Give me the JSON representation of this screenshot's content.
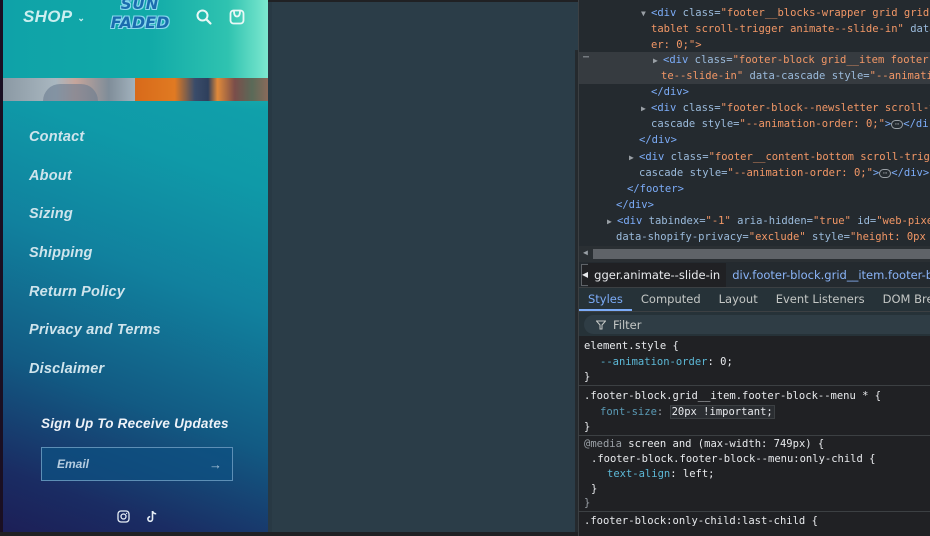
{
  "preview": {
    "header": {
      "shop_label": "SHOP",
      "logo_line1": "SUN",
      "logo_line2": "FADED",
      "icons": [
        "search-icon",
        "cart-icon"
      ]
    },
    "menu": [
      {
        "label": "Contact"
      },
      {
        "label": "About"
      },
      {
        "label": "Sizing"
      },
      {
        "label": "Shipping"
      },
      {
        "label": "Return Policy"
      },
      {
        "label": "Privacy and Terms"
      },
      {
        "label": "Disclaimer"
      }
    ],
    "newsletter": {
      "title": "Sign Up To Receive Updates",
      "email_placeholder": "Email",
      "submit_icon": "arrow-right-icon"
    },
    "socials": [
      "instagram-icon",
      "tiktok-icon"
    ]
  },
  "devtools": {
    "dom": {
      "l1_tag": "<div",
      "l1_attr": " class=",
      "l1_val": "\"footer__blocks-wrapper grid grid-",
      "l2_val": "tablet scroll-trigger animate--slide-in\"",
      "l2_attr": " data",
      "l3": "er: 0;\">",
      "l4_tag": "<div",
      "l4_attr": " class=",
      "l4_val": "\"footer-block grid__item footer-",
      "l5_val": "te--slide-in\"",
      "l5_attr": " data-cascade style=",
      "l5_val2": "\"--animati",
      "l6": "</div>",
      "l7_tag": "<div",
      "l7_attr": " class=",
      "l7_val": "\"footer-block--newsletter scroll-t",
      "l8_attr": "cascade style=",
      "l8_val": "\"--animation-order: 0;\"",
      "l8_tail": "</di",
      "l9": "</div>",
      "l10_tag": "<div",
      "l10_attr": " class=",
      "l10_val": "\"footer__content-bottom scroll-trigg",
      "l11_attr": "cascade style=",
      "l11_val": "\"--animation-order: 0;\"",
      "l11_tail": "</div>",
      "l12": "</footer>",
      "l13": "</div>",
      "l14_tag": "<div",
      "l14_attr1": " tabindex=",
      "l14_val1": "\"-1\"",
      "l14_attr2": " aria-hidden=",
      "l14_val2": "\"true\"",
      "l14_attr3": " id=",
      "l14_val3": "\"web-pixel",
      "l15_attr1": "data-shopify-privacy=",
      "l15_val1": "\"exclude\"",
      "l15_attr2": " style=",
      "l15_val2": "\"height: 0px"
    },
    "breadcrumbs": [
      "gger.animate--slide-in",
      "div.footer-block.grid__item.footer-block--"
    ],
    "tabs": [
      "Styles",
      "Computed",
      "Layout",
      "Event Listeners",
      "DOM Breakpoints"
    ],
    "active_tab": "Styles",
    "filter_placeholder": "Filter",
    "styles": {
      "r1_sel": "element.style {",
      "r1_prop": "--animation-order",
      "r1_val": "0;",
      "r2_sel": ".footer-block.grid__item.footer-block--menu * {",
      "r2_prop": "font-size",
      "r2_val": "20px !important",
      "r3_at": "@media",
      "r3_query": " screen and (max-width: 749px) {",
      "r3_sel": ".footer-block.footer-block--menu:only-child {",
      "r3_prop": "text-align",
      "r3_val": "left;",
      "r4_sel": ".footer-block:only-child:last-child {",
      "close": "}"
    }
  }
}
